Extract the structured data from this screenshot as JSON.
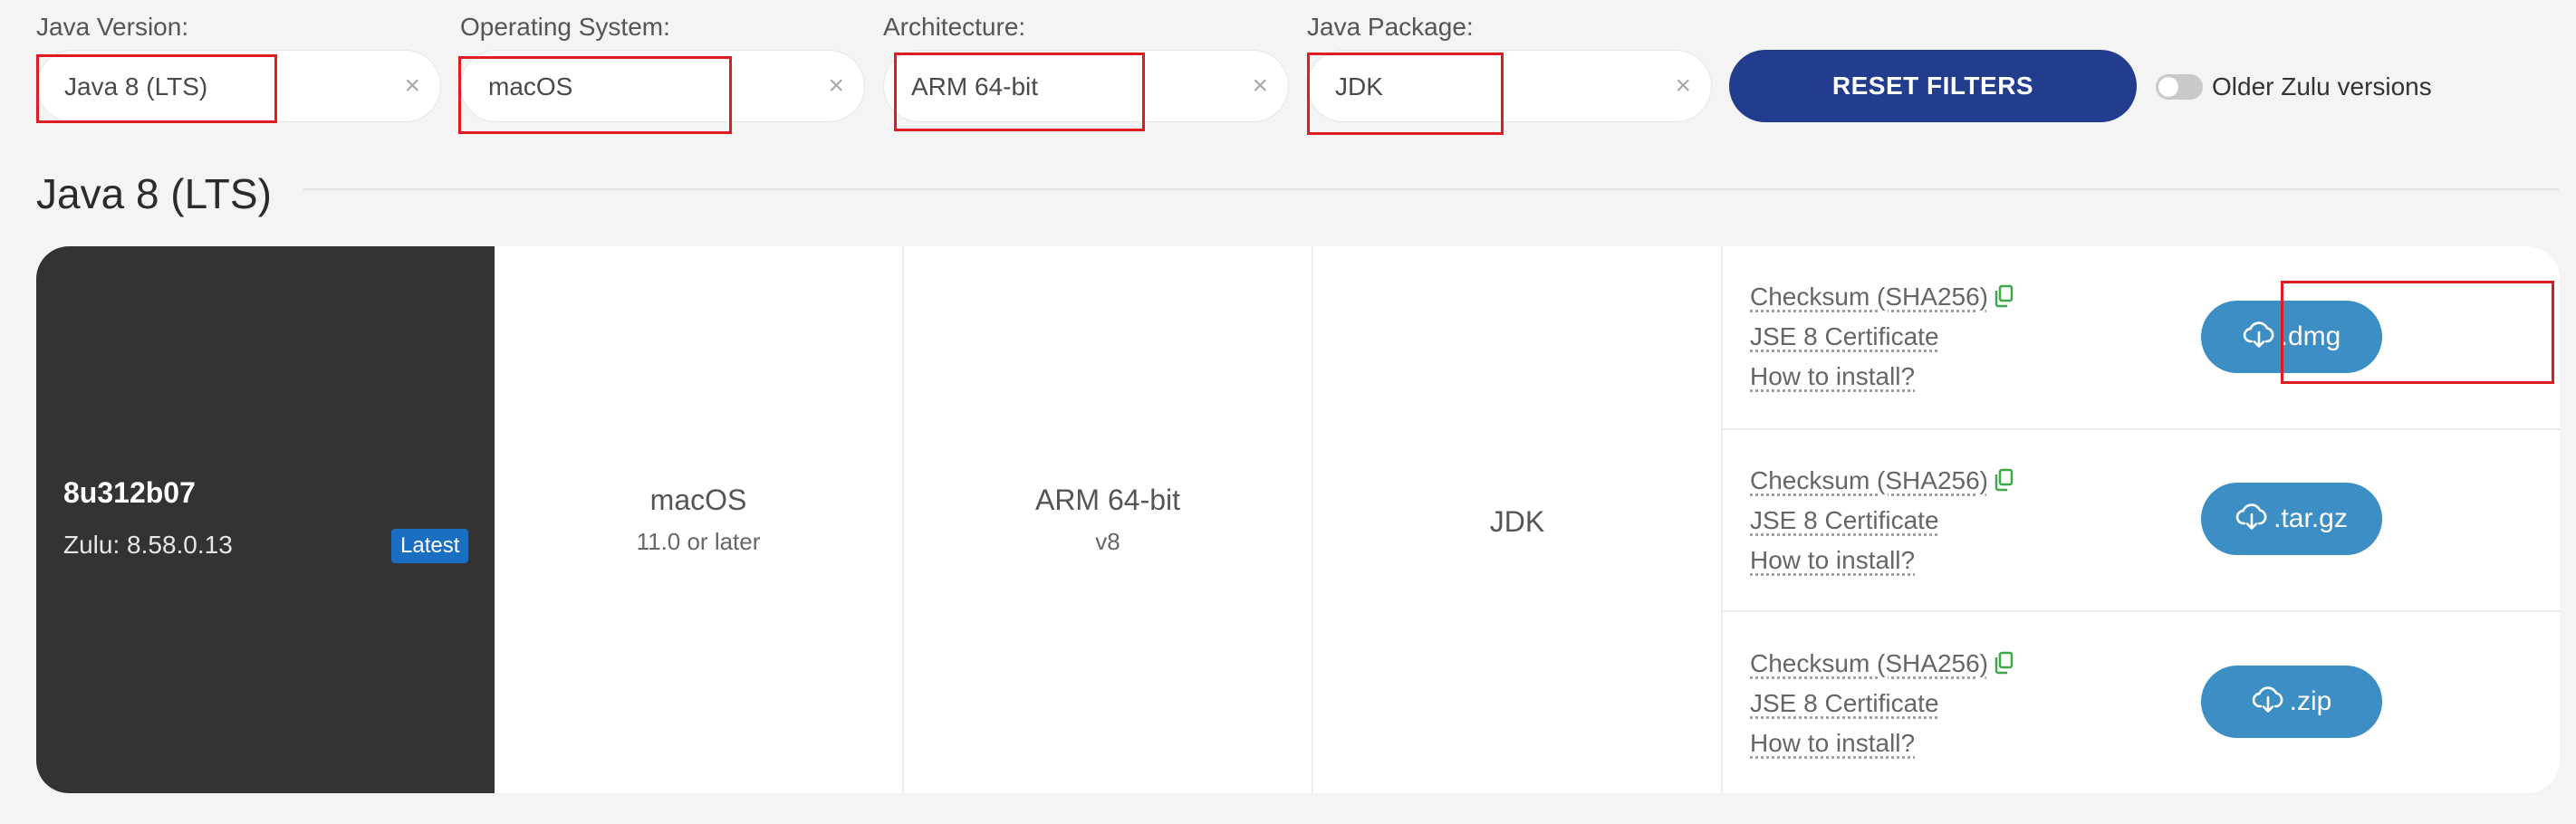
{
  "filters": {
    "java_version": {
      "label": "Java Version:",
      "value": "Java 8 (LTS)"
    },
    "operating_system": {
      "label": "Operating System:",
      "value": "macOS"
    },
    "architecture": {
      "label": "Architecture:",
      "value": "ARM 64-bit"
    },
    "java_package": {
      "label": "Java Package:",
      "value": "JDK"
    },
    "clear_symbol": "×",
    "reset_label": "RESET FILTERS",
    "older_versions_label": "Older Zulu versions"
  },
  "section_title": "Java 8 (LTS)",
  "result": {
    "version": "8u312b07",
    "zulu": "Zulu: 8.58.0.13",
    "badge": "Latest",
    "os": "macOS",
    "os_sub": "11.0 or later",
    "arch": "ARM 64-bit",
    "arch_sub": "v8",
    "package": "JDK",
    "downloads": [
      {
        "checksum": "Checksum (SHA256)",
        "certificate": "JSE 8 Certificate",
        "howto": "How to install?",
        "button": ".dmg"
      },
      {
        "checksum": "Checksum (SHA256)",
        "certificate": "JSE 8 Certificate",
        "howto": "How to install?",
        "button": ".tar.gz"
      },
      {
        "checksum": "Checksum (SHA256)",
        "certificate": "JSE 8 Certificate",
        "howto": "How to install?",
        "button": ".zip"
      }
    ]
  },
  "colors": {
    "reset_button": "#233d8e",
    "download_button": "#3d8ec4",
    "latest_badge": "#1b6fc2",
    "highlight": "#e01b22",
    "copy_icon": "#3fa64a"
  }
}
